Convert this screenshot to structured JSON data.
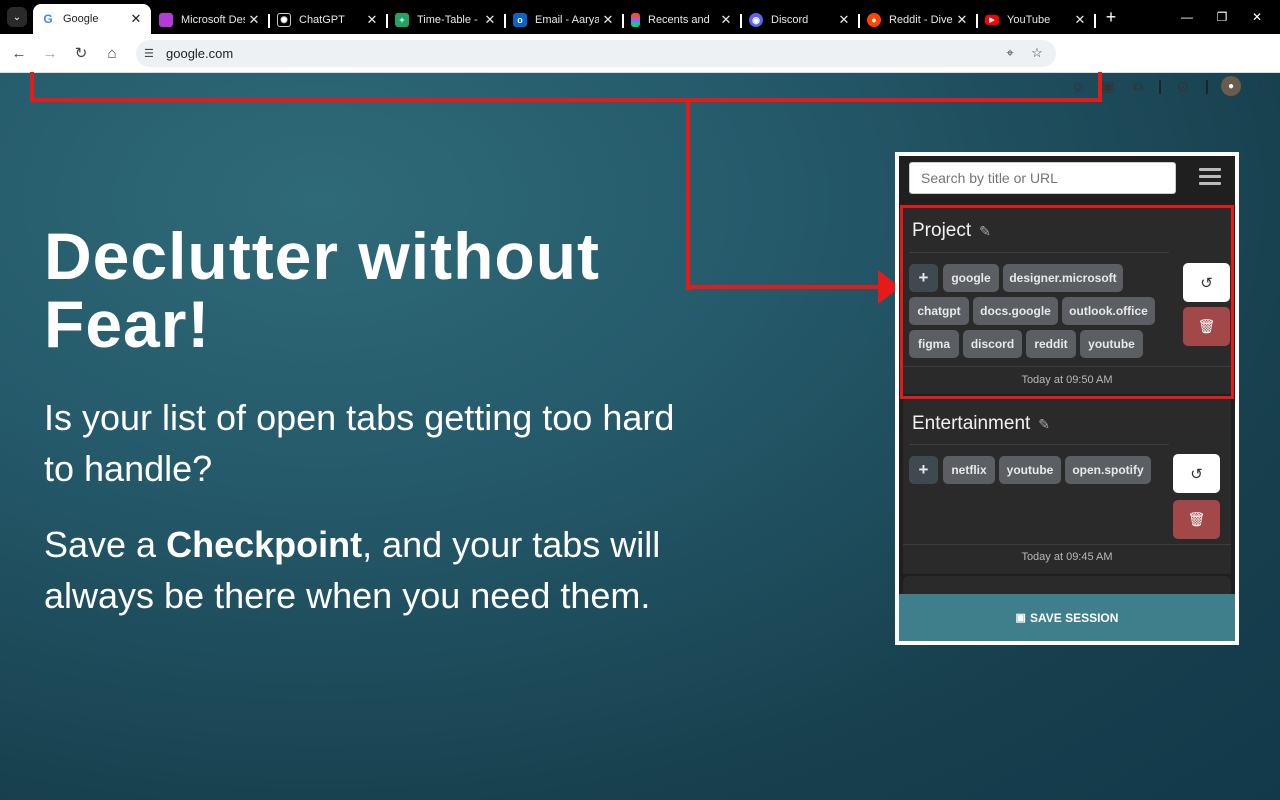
{
  "browser": {
    "tabs": [
      {
        "label": "Google",
        "favicon": "google-icon",
        "color": "#ffffff",
        "active": true
      },
      {
        "label": "Microsoft Des",
        "favicon": "microsoft-designer-icon",
        "color": "#b43cd6",
        "active": false
      },
      {
        "label": "ChatGPT",
        "favicon": "chatgpt-icon",
        "color": "#000000",
        "active": false
      },
      {
        "label": "Time-Table -",
        "favicon": "google-sheets-icon",
        "color": "#1fa463",
        "active": false
      },
      {
        "label": "Email - Aarya",
        "favicon": "outlook-icon",
        "color": "#0a64c8",
        "active": false
      },
      {
        "label": "Recents and",
        "favicon": "figma-icon",
        "color": "#f24e1e",
        "active": false
      },
      {
        "label": "Discord",
        "favicon": "discord-icon",
        "color": "#5865f2",
        "active": false
      },
      {
        "label": "Reddit - Dive",
        "favicon": "reddit-icon",
        "color": "#ff4500",
        "active": false
      },
      {
        "label": "YouTube",
        "favicon": "youtube-icon",
        "color": "#ff0000",
        "active": false
      }
    ],
    "url": "google.com"
  },
  "hero": {
    "headline": "Declutter without Fear!",
    "para1": "Is your list of open tabs getting too hard to handle?",
    "para2_start": "Save a ",
    "para2_bold": "Checkpoint",
    "para2_end": ", and your tabs will always be there when you need them."
  },
  "popup": {
    "search_placeholder": "Search by title or URL",
    "sessions": [
      {
        "name": "Project",
        "chips": [
          "google",
          "designer.microsoft",
          "chatgpt",
          "docs.google",
          "outlook.office",
          "figma",
          "discord",
          "reddit",
          "youtube"
        ],
        "time": "Today at 09:50 AM"
      },
      {
        "name": "Entertainment",
        "chips": [
          "netflix",
          "youtube",
          "open.spotify"
        ],
        "time": "Today at 09:45 AM"
      }
    ],
    "add_label": "+",
    "save_label": "SAVE SESSION"
  },
  "colors": {
    "accent": "#3f7f8c",
    "highlight": "#e51b1b",
    "delete": "#a24848"
  }
}
